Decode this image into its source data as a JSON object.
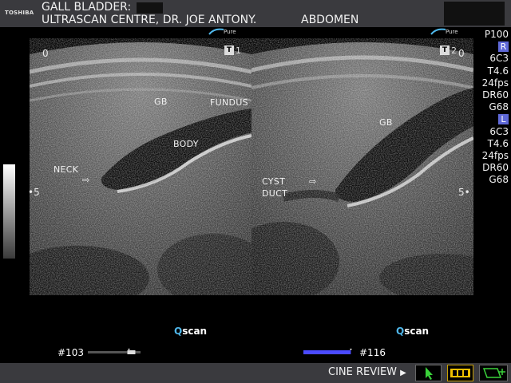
{
  "header": {
    "logo": "TOSHIBA",
    "title": "GALL BLADDER:",
    "centre": "ULTRASCAN CENTRE, DR. JOE ANTONY.",
    "study": "ABDOMEN",
    "brand_badge": "Pure"
  },
  "left_image": {
    "depth_top": "0",
    "depth_mid": "5",
    "t_label": "T",
    "t_index": "1",
    "labels": {
      "gb": "GB",
      "fundus": "FUNDUS",
      "body": "BODY",
      "neck": "NECK"
    },
    "qscan_q": "Q",
    "qscan_rest": "scan",
    "frame": "#103",
    "frame_position": 0.78
  },
  "right_image": {
    "depth_top": "0",
    "depth_mid": "5",
    "t_label": "T",
    "t_index": "2",
    "labels": {
      "gb": "GB",
      "cyst": "CYST",
      "duct": "DUCT"
    },
    "qscan_q": "Q",
    "qscan_rest": "scan",
    "frame": "#116",
    "frame_position": 0.9
  },
  "params": {
    "preset": "P100",
    "right_badge": "R",
    "right": [
      "6C3",
      "T4.6",
      "24fps",
      "DR60",
      "G68"
    ],
    "left_badge": "L",
    "left": [
      "6C3",
      "T4.6",
      "24fps",
      "DR60",
      "G68"
    ]
  },
  "footer": {
    "cine_review": "CINE REVIEW"
  },
  "colors": {
    "header_bg": "#3a3a3e",
    "badge_blue": "#5f69d8",
    "qscan_blue": "#4fb7ea",
    "active_slider": "#4a4aff"
  },
  "icons": {
    "play": "play-triangle-icon",
    "pointer": "cursor-arrow-icon",
    "film": "film-strip-icon",
    "add_annotation": "annotation-add-icon"
  }
}
